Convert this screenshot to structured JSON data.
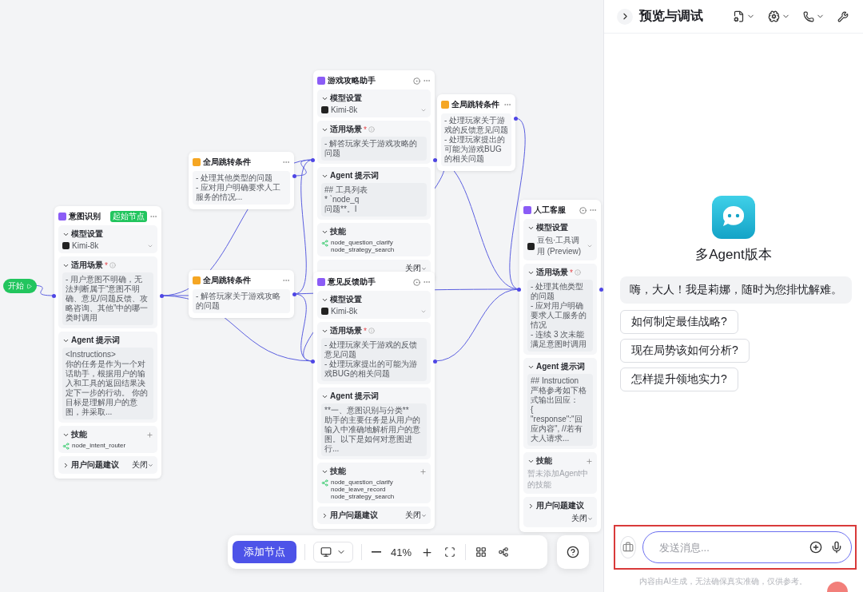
{
  "canvas": {
    "start_node": {
      "label": "开始"
    },
    "agents": [
      {
        "title": "意图识别",
        "tag": "起始节点",
        "sections": [
          {
            "kind": "model",
            "label": "模型设置",
            "expanded": true,
            "value": "Kimi-8k"
          },
          {
            "kind": "text",
            "label": "适用场景",
            "mark": "*",
            "expanded": true,
            "lines": [
              "- 用户意图不明确，无法判断属于“意图不明确、意见/问题反馈、攻略咨询、其他”中的哪一类时调用"
            ]
          },
          {
            "kind": "text",
            "label": "Agent 提示词",
            "expanded": true,
            "lines": [
              "<Instructions>",
              "你的任务是作为一个对话助手，根据用户的输入和工具的返回结果决定下一步的行动。 你的目标是理解用户的意图，并采取..."
            ]
          },
          {
            "kind": "skills",
            "label": "技能",
            "expanded": true,
            "addable": true,
            "items": [
              "node_intent_router"
            ]
          },
          {
            "kind": "toggle",
            "label": "用户问题建议",
            "expanded": false,
            "value": "关闭"
          }
        ]
      },
      {
        "title": "游戏攻略助手",
        "sections": [
          {
            "kind": "model",
            "label": "模型设置",
            "expanded": true,
            "value": "Kimi-8k"
          },
          {
            "kind": "text",
            "label": "适用场景",
            "mark": "*",
            "expanded": true,
            "lines": [
              "- 解答玩家关于游戏攻略的问题"
            ]
          },
          {
            "kind": "text",
            "label": "Agent 提示词",
            "expanded": true,
            "lines": [
              "## 工具列表",
              "* `node_q",
              "问题**。I"
            ]
          },
          {
            "kind": "skills",
            "label": "技能",
            "expanded": true,
            "addable": false,
            "items": [
              "node_question_clarify",
              "node_strategy_search"
            ]
          },
          {
            "kind": "toggle",
            "value": "关闭"
          }
        ]
      },
      {
        "title": "意见反馈助手",
        "sections": [
          {
            "kind": "model",
            "label": "模型设置",
            "expanded": true,
            "value": "Kimi-8k"
          },
          {
            "kind": "text",
            "label": "适用场景",
            "mark": "*",
            "expanded": true,
            "lines": [
              "- 处理玩家关于游戏的反馈意见问题",
              "- 处理玩家提出的可能为游戏BUG的相关问题"
            ]
          },
          {
            "kind": "text",
            "label": "Agent 提示词",
            "expanded": true,
            "lines": [
              "**一、意图识别与分类**",
              "助手的主要任务是从用户的输入中准确地解析用户的意图。以下是如何对意图进行..."
            ]
          },
          {
            "kind": "skills",
            "label": "技能",
            "expanded": true,
            "addable": true,
            "items": [
              "node_question_clarify",
              "node_leave_record",
              "node_strategy_search"
            ]
          },
          {
            "kind": "toggle",
            "label": "用户问题建议",
            "expanded": false,
            "value": "关闭"
          }
        ]
      },
      {
        "title": "人工客服",
        "sections": [
          {
            "kind": "model",
            "label": "模型设置",
            "expanded": true,
            "value": "豆包·工具调用 (Preview)"
          },
          {
            "kind": "text",
            "label": "适用场景",
            "mark": "*",
            "expanded": true,
            "lines": [
              "- 处理其他类型的问题",
              "- 应对用户明确要求人工服务的情况",
              "- 连续 3 次未能满足意图时调用"
            ]
          },
          {
            "kind": "text",
            "label": "Agent 提示词",
            "expanded": true,
            "lines": [
              "## Instruction",
              "严格参考如下格式输出回应：",
              "{",
              "\"response\":\"回应内容\", //若有大人请求..."
            ]
          },
          {
            "kind": "skills",
            "label": "技能",
            "expanded": true,
            "addable": true,
            "placeholder": "暂未添加Agent中的技能"
          },
          {
            "kind": "toggle",
            "label": "用户问题建议",
            "expanded": false,
            "value": "关闭"
          }
        ]
      }
    ],
    "jump_conditions": [
      {
        "title": "全局跳转条件",
        "lines": [
          "- 处理其他类型的问题",
          "- 应对用户明确要求人工服务的情况..."
        ]
      },
      {
        "title": "全局跳转条件",
        "lines": [
          "- 处理玩家关于游戏的反馈意见问题",
          "- 处理玩家提出的可能为游戏BUG的相关问题"
        ]
      },
      {
        "title": "全局跳转条件",
        "lines": [
          "- 解答玩家关于游戏攻略的问题"
        ]
      }
    ],
    "toolbar": {
      "add_button": "添加节点",
      "zoom": "41%"
    }
  },
  "panel": {
    "title": "预览与调试",
    "bot_name": "多Agent版本",
    "greeting": "嗨，大人！我是莉娜，随时为您排忧解难。",
    "suggestions": [
      "如何制定最佳战略?",
      "现在局势该如何分析?",
      "怎样提升领地实力?"
    ],
    "input": {
      "placeholder": "发送消息..."
    },
    "disclaimer": "内容由AI生成，无法确保真实准确，仅供参考。"
  }
}
